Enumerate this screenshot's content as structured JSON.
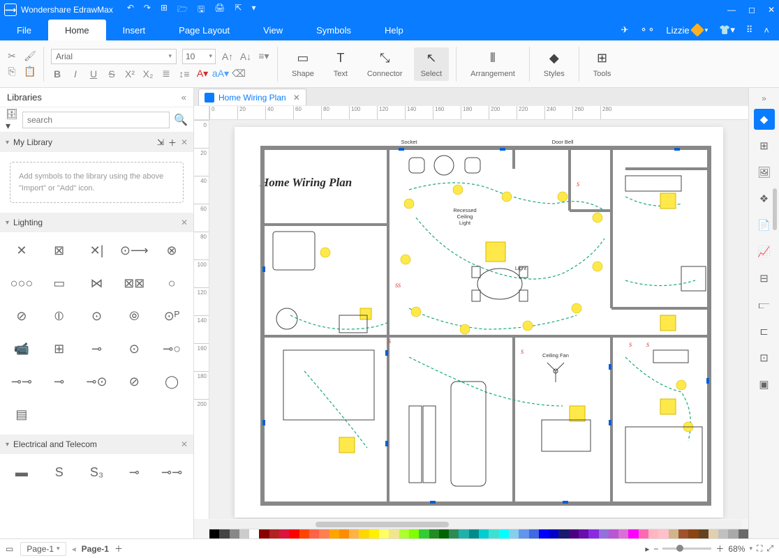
{
  "app": {
    "name": "Wondershare EdrawMax"
  },
  "titlebar_icons": [
    "undo",
    "redo",
    "new",
    "open",
    "save",
    "print",
    "export",
    "dropdown"
  ],
  "window_controls": [
    "minimize",
    "maximize",
    "close"
  ],
  "menu": [
    "File",
    "Home",
    "Insert",
    "Page Layout",
    "View",
    "Symbols",
    "Help"
  ],
  "active_menu": "Home",
  "user": {
    "name": "Lizzie"
  },
  "ribbon": {
    "font": "Arial",
    "size": "10",
    "tools": [
      {
        "id": "shape",
        "label": "Shape"
      },
      {
        "id": "text",
        "label": "Text"
      },
      {
        "id": "connector",
        "label": "Connector"
      },
      {
        "id": "select",
        "label": "Select"
      },
      {
        "id": "arrangement",
        "label": "Arrangement"
      },
      {
        "id": "styles",
        "label": "Styles"
      },
      {
        "id": "tools",
        "label": "Tools"
      }
    ],
    "selected_tool": "select"
  },
  "left_panel": {
    "title": "Libraries",
    "search_placeholder": "search",
    "sections": {
      "mylib": {
        "label": "My Library",
        "hint": "Add symbols to the library using the above \"Import\" or \"Add\" icon."
      },
      "lighting": {
        "label": "Lighting"
      },
      "elec": {
        "label": "Electrical and Telecom"
      }
    }
  },
  "document": {
    "tab_name": "Home Wiring Plan",
    "title": "Home Wiring Plan",
    "labels": {
      "socket": "Socket",
      "doorbell": "Door Bell",
      "recessed1": "Recessed",
      "recessed2": "Ceiling",
      "recessed3": "Light",
      "light": "Light",
      "fan": "Ceiling Fan"
    }
  },
  "ruler_h": [
    "0",
    "20",
    "40",
    "60",
    "80",
    "100",
    "120",
    "140",
    "160",
    "180",
    "200",
    "220",
    "240",
    "260",
    "280"
  ],
  "ruler_v": [
    "0",
    "20",
    "40",
    "60",
    "80",
    "100",
    "120",
    "140",
    "160",
    "180",
    "200"
  ],
  "colorbar": [
    "#000",
    "#444",
    "#888",
    "#ccc",
    "#fff",
    "#8b0000",
    "#b22222",
    "#dc143c",
    "#ff0000",
    "#ff4500",
    "#ff6347",
    "#ff7f50",
    "#ffa500",
    "#ff8c00",
    "#ffb347",
    "#ffd700",
    "#fff000",
    "#ffff66",
    "#f0e68c",
    "#adff2f",
    "#7fff00",
    "#32cd32",
    "#228b22",
    "#006400",
    "#2e8b57",
    "#20b2aa",
    "#008b8b",
    "#00ced1",
    "#40e0d0",
    "#00ffff",
    "#87ceeb",
    "#6495ed",
    "#4169e1",
    "#0000ff",
    "#0000cd",
    "#191970",
    "#4b0082",
    "#6a0dad",
    "#8a2be2",
    "#9370db",
    "#ba55d3",
    "#da70d6",
    "#ff00ff",
    "#ff69b4",
    "#ffb6c1",
    "#ffc0cb",
    "#d2b48c",
    "#a0522d",
    "#8b4513",
    "#654321",
    "#e0d0b0",
    "#c0c0c0",
    "#a9a9a9",
    "#696969"
  ],
  "status": {
    "page_selector": "Page-1",
    "page_tab": "Page-1",
    "zoom": "68%"
  },
  "right_panel_icons": [
    "theme",
    "grid",
    "image",
    "layers",
    "page",
    "chart",
    "table",
    "align",
    "format",
    "comment",
    "present"
  ]
}
